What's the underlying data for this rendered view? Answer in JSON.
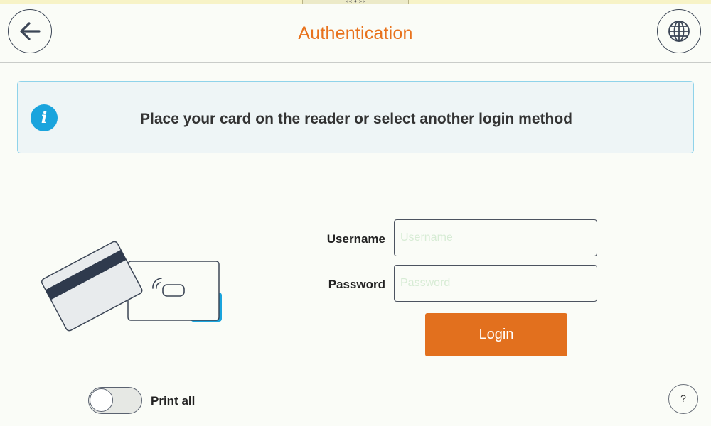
{
  "header": {
    "title": "Authentication",
    "back_icon": "arrow-left-icon",
    "language_icon": "globe-icon"
  },
  "top_strip": {
    "handle_text": "<< ♦ >>"
  },
  "info": {
    "icon": "info-icon",
    "icon_glyph": "i",
    "message": "Place your card on the reader or select another login method"
  },
  "card_reader": {
    "illustration": "card-reader-icon"
  },
  "login_form": {
    "username_label": "Username",
    "username_placeholder": "Username",
    "username_value": "",
    "password_label": "Password",
    "password_placeholder": "Password",
    "password_value": "",
    "login_label": "Login"
  },
  "print_all": {
    "label": "Print all",
    "enabled": false
  },
  "help": {
    "label": "?"
  },
  "colors": {
    "accent": "#e8721c",
    "button": "#e2701e",
    "info_blue": "#1aa4dd",
    "info_border": "#8fd3ea"
  }
}
